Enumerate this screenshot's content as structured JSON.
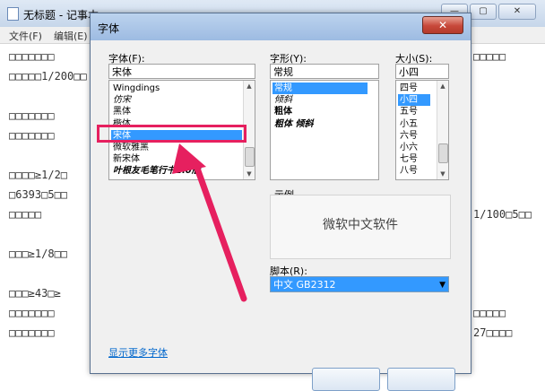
{
  "notepad": {
    "title": "无标题 - 记事本",
    "menu": [
      "文件(F)",
      "编辑(E)"
    ],
    "left_lines": [
      "□□□□□□□",
      "□□□□□1/200□□",
      "",
      "□□□□□□□",
      "□□□□□□□",
      "",
      "□□□□≥1/2□",
      "□6393□5□□",
      "□□□□□",
      "",
      "□□□≥1/8□□",
      "",
      "□□□≥43□≥",
      "□□□□□□□",
      "□□□□□□□"
    ],
    "right_lines": [
      "□□□□□",
      "",
      "",
      "",
      "",
      "",
      "",
      "",
      "1/100□5□□",
      "",
      "",
      "",
      "",
      "□□□□□",
      "27□□□□"
    ],
    "window_controls": [
      "—",
      "▢",
      "✕"
    ]
  },
  "dialog": {
    "title": "字体",
    "close_label": "✕",
    "font_label": "字体(F):",
    "font_value": "宋体",
    "font_list": [
      {
        "label": "Wingdings",
        "selected": false
      },
      {
        "label": "仿宋",
        "selected": false
      },
      {
        "label": "黑体",
        "selected": false
      },
      {
        "label": "楷体",
        "selected": false
      },
      {
        "label": "宋体",
        "selected": true
      },
      {
        "label": "微软雅黑",
        "selected": false
      },
      {
        "label": "新宋体",
        "selected": false
      },
      {
        "label": "叶根友毛笔行书2.0版",
        "selected": false
      }
    ],
    "style_label": "字形(Y):",
    "style_value": "常规",
    "style_list": [
      {
        "label": "常规",
        "selected": true
      },
      {
        "label": "倾斜",
        "selected": false
      },
      {
        "label": "粗体",
        "selected": false
      },
      {
        "label": "粗体 倾斜",
        "selected": false
      }
    ],
    "size_label": "大小(S):",
    "size_value": "小四",
    "size_list": [
      {
        "label": "四号",
        "selected": false
      },
      {
        "label": "小四",
        "selected": true
      },
      {
        "label": "五号",
        "selected": false
      },
      {
        "label": "小五",
        "selected": false
      },
      {
        "label": "六号",
        "selected": false
      },
      {
        "label": "小六",
        "selected": false
      },
      {
        "label": "七号",
        "selected": false
      },
      {
        "label": "八号",
        "selected": false
      }
    ],
    "sample_label": "示例",
    "sample_text": "微软中文软件",
    "script_label": "脚本(R):",
    "script_value": "中文 GB2312",
    "more_fonts_link": "显示更多字体"
  },
  "colors": {
    "selection": "#3399ff",
    "highlight": "#e6205f",
    "link": "#0066cc"
  }
}
